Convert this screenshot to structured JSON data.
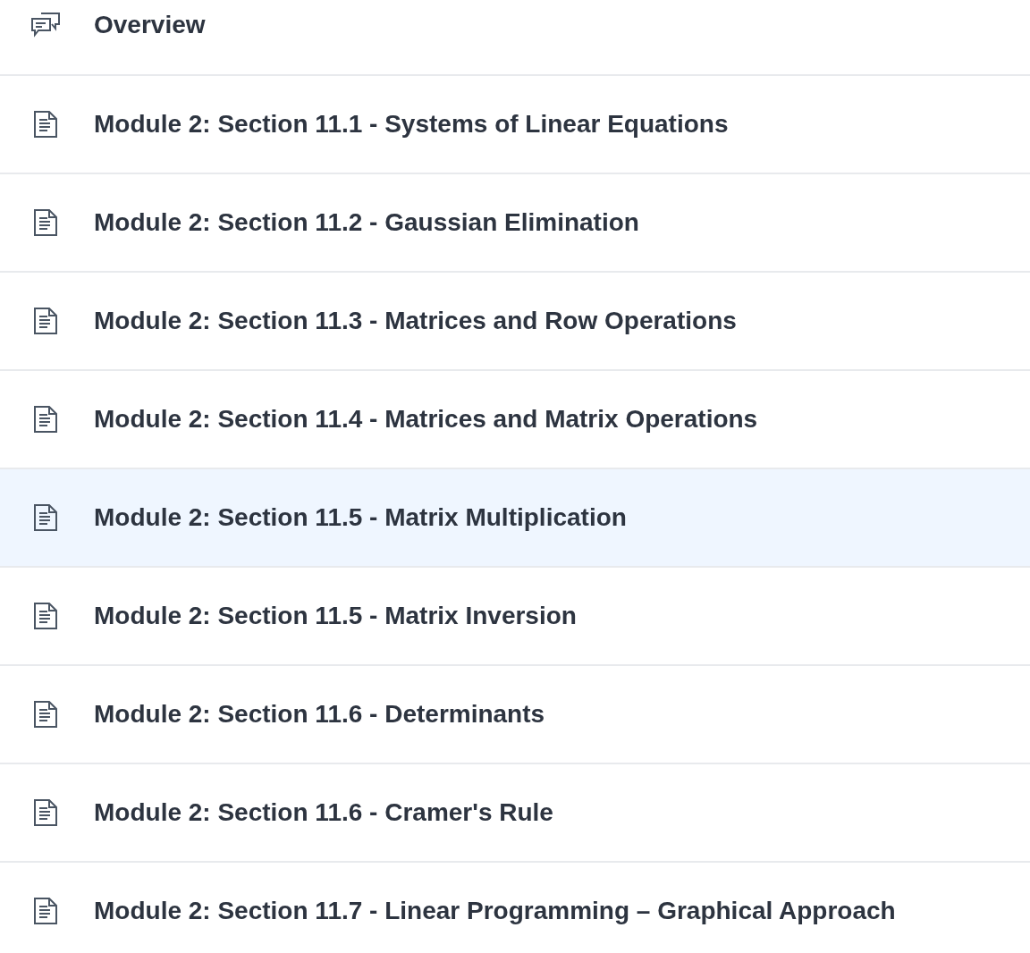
{
  "items": [
    {
      "kind": "discussion",
      "title": "Overview",
      "selected": false
    },
    {
      "kind": "page",
      "title": "Module 2: Section 11.1 - Systems of Linear Equations",
      "selected": false
    },
    {
      "kind": "page",
      "title": "Module 2: Section 11.2 - Gaussian Elimination",
      "selected": false
    },
    {
      "kind": "page",
      "title": "Module 2: Section 11.3 - Matrices and Row Operations",
      "selected": false
    },
    {
      "kind": "page",
      "title": "Module 2: Section 11.4 - Matrices and Matrix Operations",
      "selected": false
    },
    {
      "kind": "page",
      "title": "Module 2: Section 11.5 - Matrix Multiplication",
      "selected": true
    },
    {
      "kind": "page",
      "title": "Module 2: Section 11.5 - Matrix Inversion",
      "selected": false
    },
    {
      "kind": "page",
      "title": "Module 2: Section 11.6 - Determinants",
      "selected": false
    },
    {
      "kind": "page",
      "title": "Module 2: Section 11.6 - Cramer's Rule",
      "selected": false
    },
    {
      "kind": "page",
      "title": "Module 2: Section 11.7 - Linear Programming – Graphical Approach",
      "selected": false
    }
  ]
}
